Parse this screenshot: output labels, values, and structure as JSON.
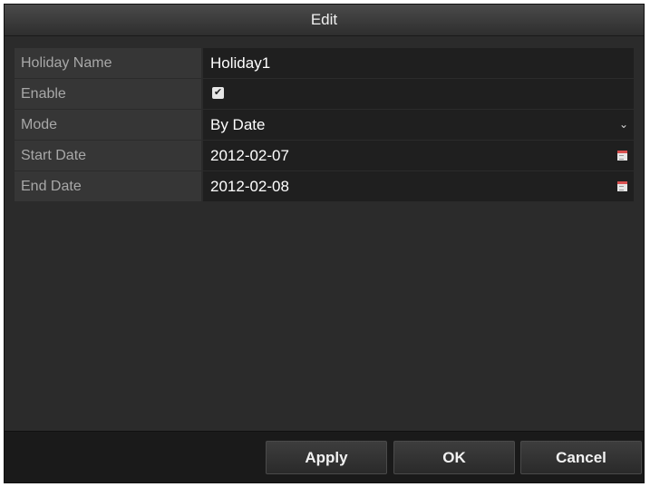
{
  "dialog": {
    "title": "Edit"
  },
  "form": {
    "holiday_name": {
      "label": "Holiday Name",
      "value": "Holiday1"
    },
    "enable": {
      "label": "Enable",
      "checked": true,
      "check_glyph": "✔"
    },
    "mode": {
      "label": "Mode",
      "value": "By Date",
      "chevron": "⌄"
    },
    "start_date": {
      "label": "Start Date",
      "value": "2012-02-07"
    },
    "end_date": {
      "label": "End Date",
      "value": "2012-02-08"
    }
  },
  "buttons": {
    "apply": "Apply",
    "ok": "OK",
    "cancel": "Cancel"
  },
  "icons": {
    "checkbox": "checkbox-checked-icon",
    "dropdown": "chevron-down-icon",
    "calendar": "calendar-icon"
  },
  "colors": {
    "background": "#2b2b2b",
    "label_bg": "#363636",
    "value_bg": "#1f1f1f",
    "footer_bg": "#1a1a1a",
    "calendar_accent": "#d85050"
  }
}
